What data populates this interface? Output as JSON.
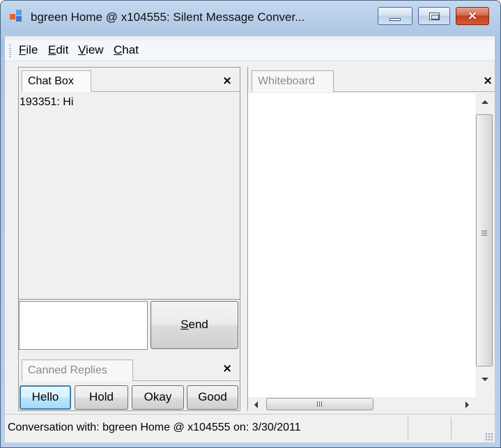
{
  "window": {
    "title": "bgreen Home @  x104555: Silent Message Conver...",
    "controls": {
      "minimize": "minimize",
      "maximize": "maximize",
      "close": "×"
    }
  },
  "menu": {
    "items": [
      {
        "label": "File",
        "accel": "F",
        "rest": "ile"
      },
      {
        "label": "Edit",
        "accel": "E",
        "rest": "dit"
      },
      {
        "label": "View",
        "accel": "V",
        "rest": "iew"
      },
      {
        "label": "Chat",
        "accel": "C",
        "rest": "hat"
      }
    ]
  },
  "chat_panel": {
    "tab_label": "Chat Box",
    "close_glyph": "×",
    "messages": [
      "193351: Hi"
    ],
    "input_value": "",
    "send_accel": "S",
    "send_rest": "end"
  },
  "canned_panel": {
    "tab_label": "Canned Replies",
    "close_glyph": "×",
    "buttons": [
      "Hello",
      "Hold",
      "Okay",
      "Good"
    ]
  },
  "whiteboard_panel": {
    "tab_label": "Whiteboard",
    "close_glyph": "×",
    "hscroll_grip": "III"
  },
  "status": {
    "text": "Conversation with: bgreen Home @  x104555 on: 3/30/2011"
  },
  "colors": {
    "title_gradient_top": "#c4d8ee",
    "close_button": "#c3401f",
    "focused_button_border": "#3c7fb1"
  }
}
